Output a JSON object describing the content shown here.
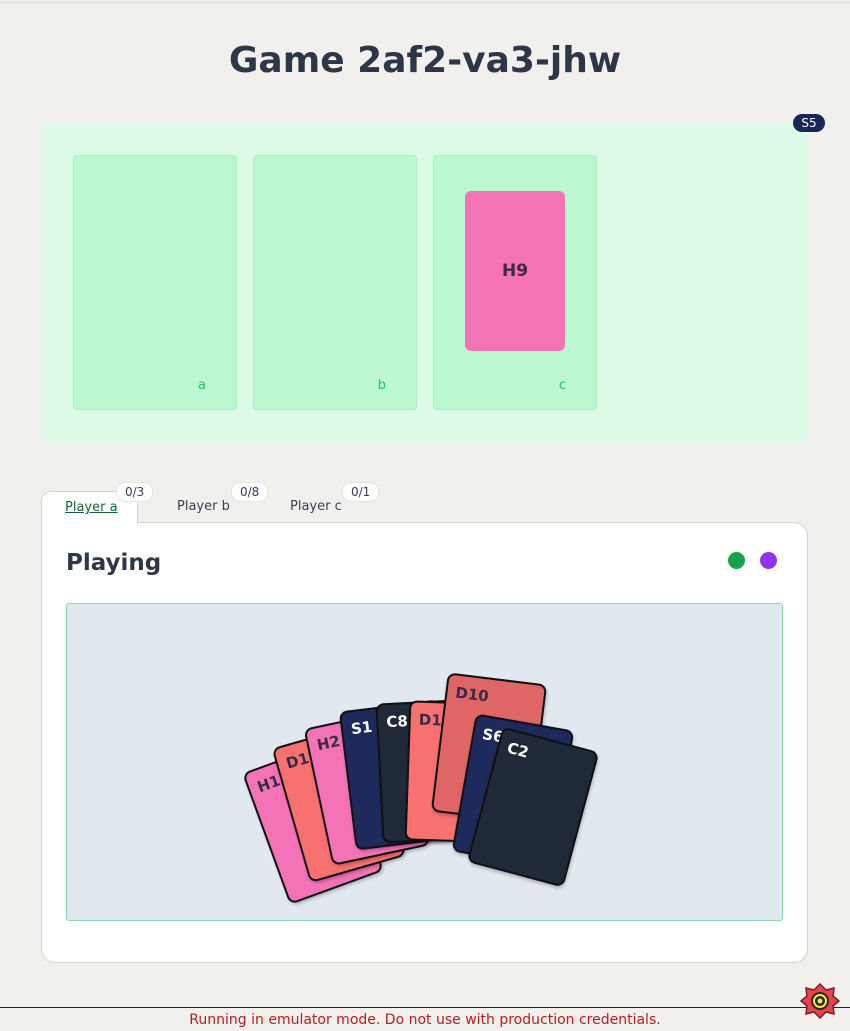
{
  "title": "Game 2af2-va3-jhw",
  "stack_badge": "S5",
  "slots": [
    {
      "label": "a",
      "card": null
    },
    {
      "label": "b",
      "card": null
    },
    {
      "label": "c",
      "card": "H9"
    }
  ],
  "tabs": [
    {
      "label": "Player a",
      "count": "0/3",
      "active": true
    },
    {
      "label": "Player b",
      "count": "0/8",
      "active": false
    },
    {
      "label": "Player c",
      "count": "0/1",
      "active": false
    }
  ],
  "panel": {
    "title": "Playing",
    "status_dots": [
      "#16a34a",
      "#9333ea"
    ]
  },
  "hand": [
    {
      "label": "H11",
      "color": "#f472b6",
      "text": "#3b2a4a"
    },
    {
      "label": "D12",
      "color": "#f87171",
      "text": "#3b2a4a"
    },
    {
      "label": "H2",
      "color": "#f472b6",
      "text": "#3b2a4a"
    },
    {
      "label": "S1",
      "color": "#1e2a5c",
      "text": "#ffffff"
    },
    {
      "label": "C8",
      "color": "#1f2937",
      "text": "#ffffff"
    },
    {
      "label": "D11",
      "color": "#f87171",
      "text": "#3b2a4a"
    },
    {
      "label": "D10",
      "color": "#e06666",
      "text": "#3b2a4a"
    },
    {
      "label": "S6",
      "color": "#1e2a5c",
      "text": "#ffffff"
    },
    {
      "label": "C2",
      "color": "#1f2937",
      "text": "#ffffff"
    }
  ],
  "footer": "Running in emulator mode. Do not use with production credentials."
}
